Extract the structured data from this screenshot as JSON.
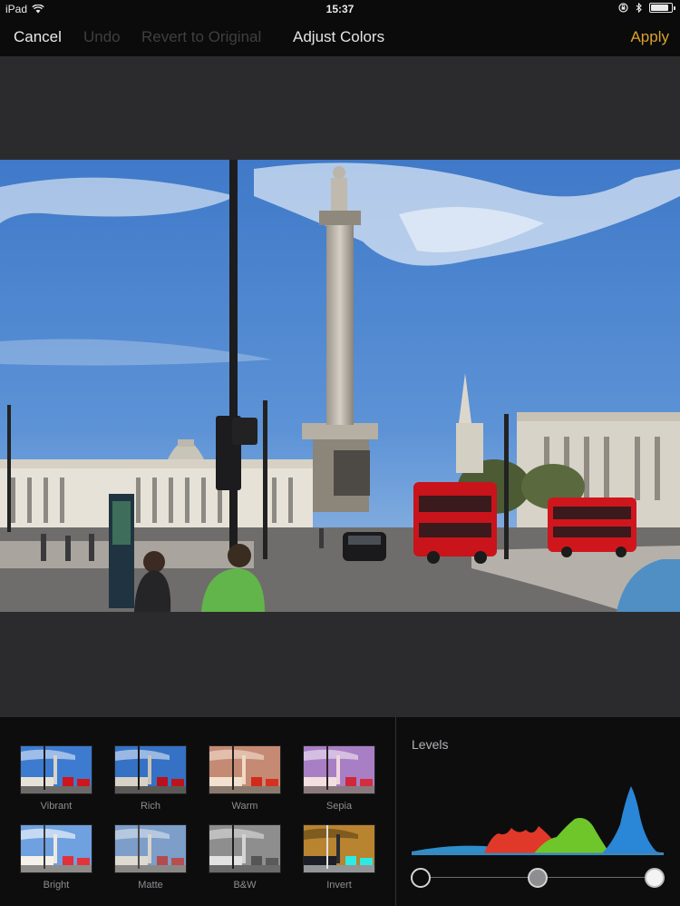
{
  "status": {
    "device": "iPad",
    "time": "15:37"
  },
  "nav": {
    "cancel": "Cancel",
    "undo": "Undo",
    "revert": "Revert to Original",
    "title": "Adjust Colors",
    "apply": "Apply"
  },
  "presets": [
    {
      "label": "Vibrant"
    },
    {
      "label": "Rich"
    },
    {
      "label": "Warm"
    },
    {
      "label": "Sepia"
    },
    {
      "label": "Bright"
    },
    {
      "label": "Matte"
    },
    {
      "label": "B&W"
    },
    {
      "label": "Invert"
    }
  ],
  "levels": {
    "title": "Levels",
    "black_point": 0,
    "mid_point": 0.5,
    "white_point": 1
  },
  "colors": {
    "accent": "#d9a22a",
    "background": "#2b2b2d",
    "panel": "#0d0d0e"
  }
}
